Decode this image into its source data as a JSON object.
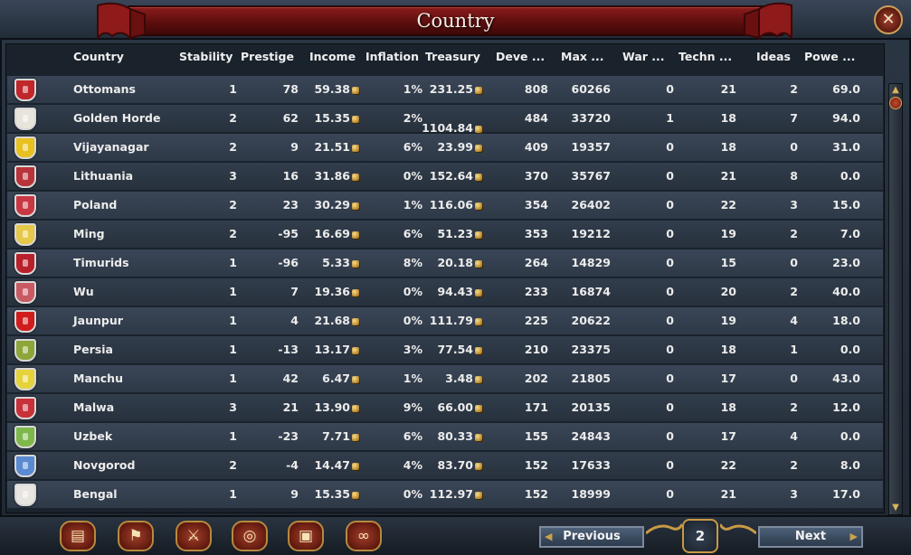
{
  "window": {
    "title": "Country",
    "close_label": "✕"
  },
  "columns": {
    "country": "Country",
    "stability": "Stability",
    "prestige": "Prestige",
    "income": "Income",
    "inflation": "Inflation",
    "treasury": "Treasury",
    "development": "Deve ...",
    "max": "Max  ...",
    "war": "War  ...",
    "tech": "Techn ...",
    "ideas": "Ideas",
    "power": "Powe ..."
  },
  "rows": [
    {
      "name": "Ottomans",
      "stability": "1",
      "prestige": "78",
      "income": "59.38",
      "inflation": "1%",
      "treasury": "231.25",
      "development": "808",
      "max": "60266",
      "war": "0",
      "tech": "21",
      "ideas": "2",
      "power": "69.0",
      "flag_color": "#c0262a"
    },
    {
      "name": "Golden Horde",
      "stability": "2",
      "prestige": "62",
      "income": "15.35",
      "inflation": "2%",
      "treasury": "1104.84",
      "development": "484",
      "max": "33720",
      "war": "1",
      "tech": "18",
      "ideas": "7",
      "power": "94.0",
      "flag_color": "#e8e4dc"
    },
    {
      "name": "Vijayanagar",
      "stability": "2",
      "prestige": "9",
      "income": "21.51",
      "inflation": "6%",
      "treasury": "23.99",
      "development": "409",
      "max": "19357",
      "war": "0",
      "tech": "18",
      "ideas": "0",
      "power": "31.0",
      "flag_color": "#e8c020"
    },
    {
      "name": "Lithuania",
      "stability": "3",
      "prestige": "16",
      "income": "31.86",
      "inflation": "0%",
      "treasury": "152.64",
      "development": "370",
      "max": "35767",
      "war": "0",
      "tech": "21",
      "ideas": "8",
      "power": "0.0",
      "flag_color": "#b8343a"
    },
    {
      "name": "Poland",
      "stability": "2",
      "prestige": "23",
      "income": "30.29",
      "inflation": "1%",
      "treasury": "116.06",
      "development": "354",
      "max": "26402",
      "war": "0",
      "tech": "22",
      "ideas": "3",
      "power": "15.0",
      "flag_color": "#c83844"
    },
    {
      "name": "Ming",
      "stability": "2",
      "prestige": "-95",
      "income": "16.69",
      "inflation": "6%",
      "treasury": "51.23",
      "development": "353",
      "max": "19212",
      "war": "0",
      "tech": "19",
      "ideas": "2",
      "power": "7.0",
      "flag_color": "#e6c84a"
    },
    {
      "name": "Timurids",
      "stability": "1",
      "prestige": "-96",
      "income": "5.33",
      "inflation": "8%",
      "treasury": "20.18",
      "development": "264",
      "max": "14829",
      "war": "0",
      "tech": "15",
      "ideas": "0",
      "power": "23.0",
      "flag_color": "#b8202c"
    },
    {
      "name": "Wu",
      "stability": "1",
      "prestige": "7",
      "income": "19.36",
      "inflation": "0%",
      "treasury": "94.43",
      "development": "233",
      "max": "16874",
      "war": "0",
      "tech": "20",
      "ideas": "2",
      "power": "40.0",
      "flag_color": "#c85a64"
    },
    {
      "name": "Jaunpur",
      "stability": "1",
      "prestige": "4",
      "income": "21.68",
      "inflation": "0%",
      "treasury": "111.79",
      "development": "225",
      "max": "20622",
      "war": "0",
      "tech": "19",
      "ideas": "4",
      "power": "18.0",
      "flag_color": "#d01c1c"
    },
    {
      "name": "Persia",
      "stability": "1",
      "prestige": "-13",
      "income": "13.17",
      "inflation": "3%",
      "treasury": "77.54",
      "development": "210",
      "max": "23375",
      "war": "0",
      "tech": "18",
      "ideas": "1",
      "power": "0.0",
      "flag_color": "#8ca63a"
    },
    {
      "name": "Manchu",
      "stability": "1",
      "prestige": "42",
      "income": "6.47",
      "inflation": "1%",
      "treasury": "3.48",
      "development": "202",
      "max": "21805",
      "war": "0",
      "tech": "17",
      "ideas": "0",
      "power": "43.0",
      "flag_color": "#e6d23a"
    },
    {
      "name": "Malwa",
      "stability": "3",
      "prestige": "21",
      "income": "13.90",
      "inflation": "9%",
      "treasury": "66.00",
      "development": "171",
      "max": "20135",
      "war": "0",
      "tech": "18",
      "ideas": "2",
      "power": "12.0",
      "flag_color": "#c8303a"
    },
    {
      "name": "Uzbek",
      "stability": "1",
      "prestige": "-23",
      "income": "7.71",
      "inflation": "6%",
      "treasury": "80.33",
      "development": "155",
      "max": "24843",
      "war": "0",
      "tech": "17",
      "ideas": "4",
      "power": "0.0",
      "flag_color": "#7fb84a"
    },
    {
      "name": "Novgorod",
      "stability": "2",
      "prestige": "-4",
      "income": "14.47",
      "inflation": "4%",
      "treasury": "83.70",
      "development": "152",
      "max": "17633",
      "war": "0",
      "tech": "22",
      "ideas": "2",
      "power": "8.0",
      "flag_color": "#5a8ad0"
    },
    {
      "name": "Bengal",
      "stability": "1",
      "prestige": "9",
      "income": "15.35",
      "inflation": "0%",
      "treasury": "112.97",
      "development": "152",
      "max": "18999",
      "war": "0",
      "tech": "21",
      "ideas": "3",
      "power": "17.0",
      "flag_color": "#e8e4e0"
    }
  ],
  "footer": {
    "previous_label": "Previous",
    "next_label": "Next",
    "page_number": "2",
    "menu_buttons": [
      "ledger-icon",
      "flag-icon",
      "crossed-swords-icon",
      "coins-icon",
      "crate-icon",
      "handshake-icon"
    ]
  },
  "accents": {
    "title_red": "#7a1212",
    "gold": "#c89a45"
  }
}
